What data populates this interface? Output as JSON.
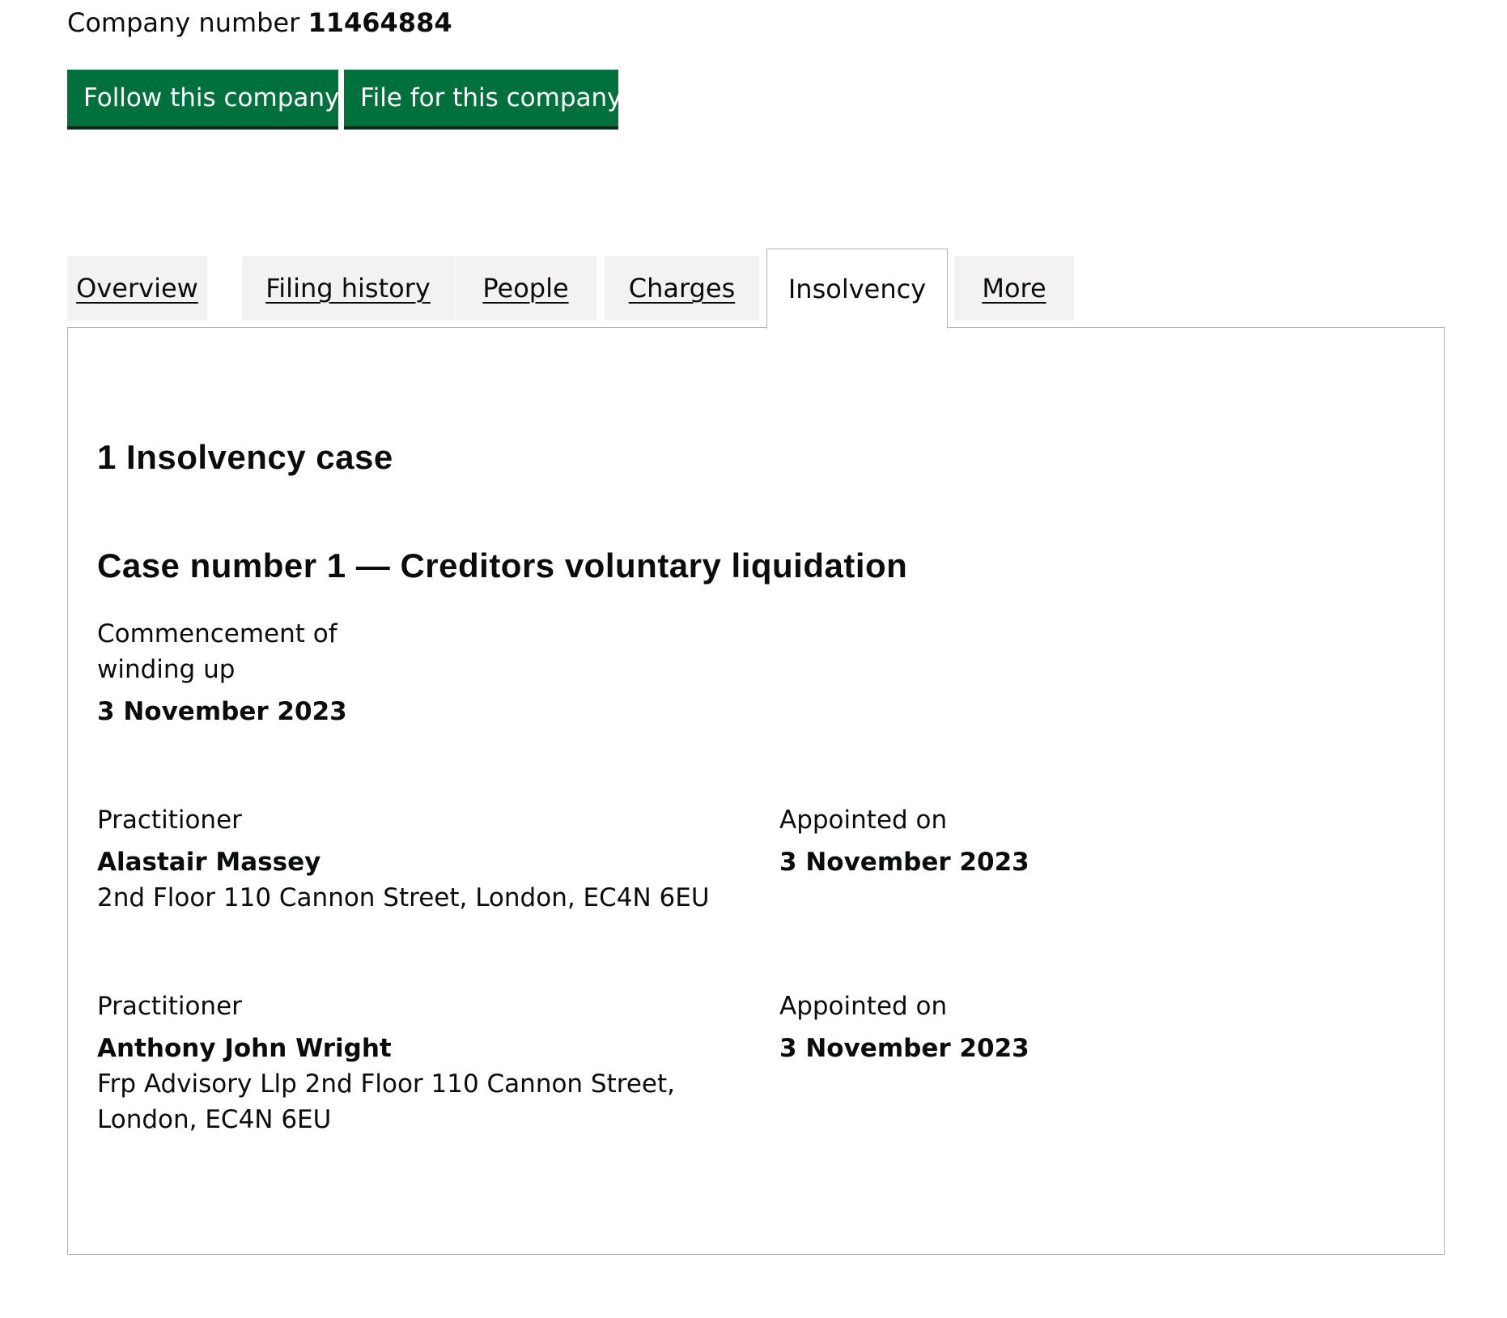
{
  "company": {
    "number_label": "Company number",
    "number": "11464884"
  },
  "actions": {
    "follow_label": "Follow this company",
    "file_label": "File for this company"
  },
  "tabs": [
    {
      "label": "Overview",
      "active": false
    },
    {
      "label": "Filing history",
      "active": false
    },
    {
      "label": "People",
      "active": false
    },
    {
      "label": "Charges",
      "active": false
    },
    {
      "label": "Insolvency",
      "active": true
    },
    {
      "label": "More",
      "active": false
    }
  ],
  "insolvency": {
    "count_heading": "1 Insolvency case",
    "case_heading": "Case number 1 — Creditors voluntary liquidation",
    "commencement": {
      "label": "Commencement of winding up",
      "date": "3 November 2023"
    },
    "practitioners": [
      {
        "label": "Practitioner",
        "name": "Alastair Massey",
        "address": "2nd Floor 110 Cannon Street, London, EC4N 6EU",
        "appointed_label": "Appointed on",
        "appointed_date": "3 November 2023"
      },
      {
        "label": "Practitioner",
        "name": "Anthony John Wright",
        "address": "Frp Advisory Llp 2nd Floor 110 Cannon Street, London, EC4N 6EU",
        "appointed_label": "Appointed on",
        "appointed_date": "3 November 2023"
      }
    ]
  },
  "colors": {
    "button_green": "#00703c",
    "button_shadow": "#002d18",
    "tab_inactive_bg": "#f3f2f1",
    "border": "#b1b4b6",
    "text": "#0b0c0c"
  }
}
